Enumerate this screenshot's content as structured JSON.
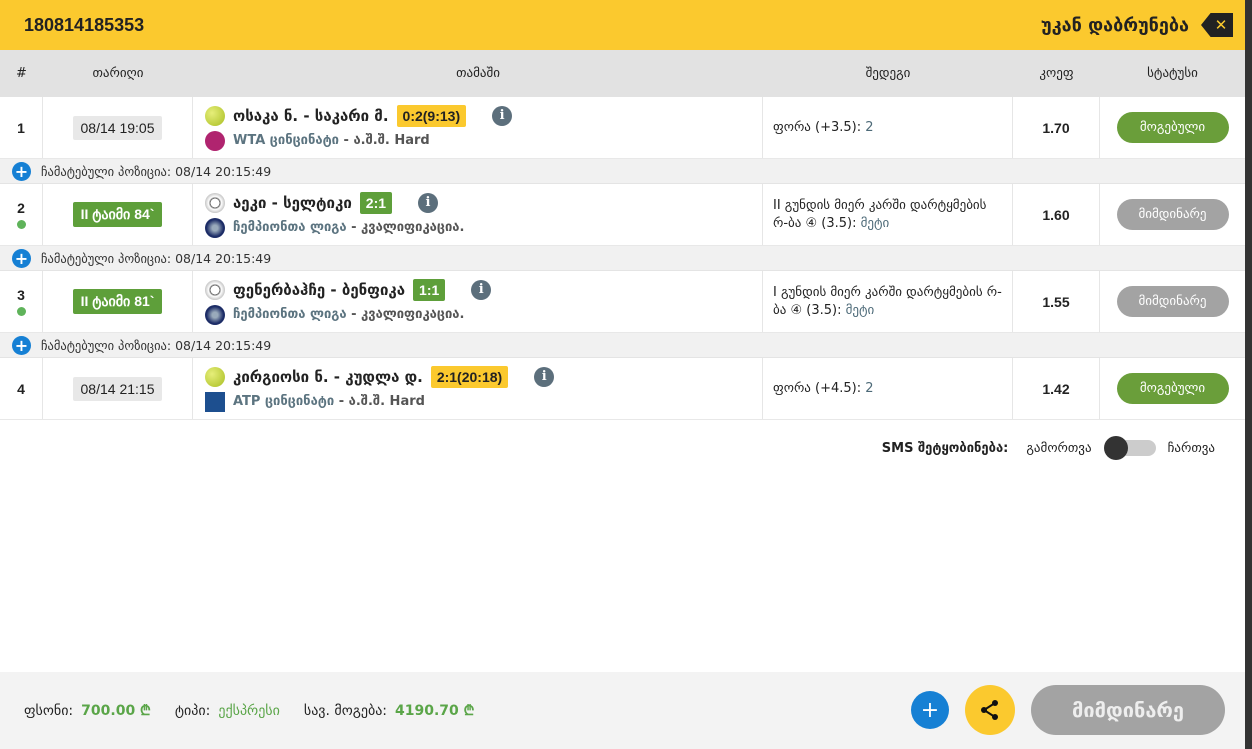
{
  "header": {
    "ticket_id": "180814185353",
    "back_label": "უკან დაბრუნება"
  },
  "columns": [
    "#",
    "თარიღი",
    "თამაში",
    "შედეგი",
    "კოეფ",
    "სტატუსი"
  ],
  "rows": [
    {
      "num": "1",
      "live": false,
      "date": "08/14 19:05",
      "sport": "tennis",
      "league_logo": "WTA",
      "teams": "ოსაკა ნ. - საკარი მ.",
      "score": "0:2(9:13)",
      "score_color": "yellow",
      "league": "WTA ცინცინატი",
      "league_sub": " - ა.შ.შ. Hard",
      "result": "ფორა (+3.5): ",
      "pick": "2",
      "coef": "1.70",
      "status": "მოგებული",
      "status_type": "won"
    },
    {
      "num": "2",
      "live": true,
      "date": "II ტაიმი 84`",
      "sport": "soccer",
      "league_logo": "CL",
      "teams": "აეკი - სელტიკი",
      "score": "2:1",
      "score_color": "green",
      "league": "ჩემპიონთა ლიგა",
      "league_sub": " - კვალიფიკაცია.",
      "result": "II გუნდის მიერ კარში დარტყმების რ-ბა ④ (3.5): ",
      "pick": "მეტი",
      "coef": "1.60",
      "status": "მიმდინარე",
      "status_type": "current"
    },
    {
      "num": "3",
      "live": true,
      "date": "II ტაიმი 81`",
      "sport": "soccer",
      "league_logo": "CL",
      "teams": "ფენერბაჰჩე - ბენფიკა",
      "score": "1:1",
      "score_color": "green",
      "league": "ჩემპიონთა ლიგა",
      "league_sub": " - კვალიფიკაცია.",
      "result": "I გუნდის მიერ კარში დარტყმების რ-ბა ④ (3.5): ",
      "pick": "მეტი",
      "coef": "1.55",
      "status": "მიმდინარე",
      "status_type": "current"
    },
    {
      "num": "4",
      "live": false,
      "date": "08/14 21:15",
      "sport": "tennis",
      "league_logo": "ATP",
      "teams": "კირგიოსი ნ. - კუდლა დ.",
      "score": "2:1(20:18)",
      "score_color": "yellow",
      "league": "ATP ცინცინატი",
      "league_sub": " - ა.შ.შ. Hard",
      "result": "ფორა (+4.5): ",
      "pick": "2",
      "coef": "1.42",
      "status": "მოგებული",
      "status_type": "won"
    }
  ],
  "added_label": "ჩამატებული პოზიცია: 08/14 20:15:49",
  "sms": {
    "label": "SMS შეტყობინება:",
    "off": "გამორთვა",
    "on": "ჩართვა",
    "enabled": false
  },
  "footer": {
    "stake_label": "ფსონი:",
    "stake": "700.00 ₾",
    "type_label": "ტიპი:",
    "type": "ექსპრესი",
    "win_label": "სავ. მოგება:",
    "win": "4190.70 ₾",
    "status": "მიმდინარე"
  }
}
